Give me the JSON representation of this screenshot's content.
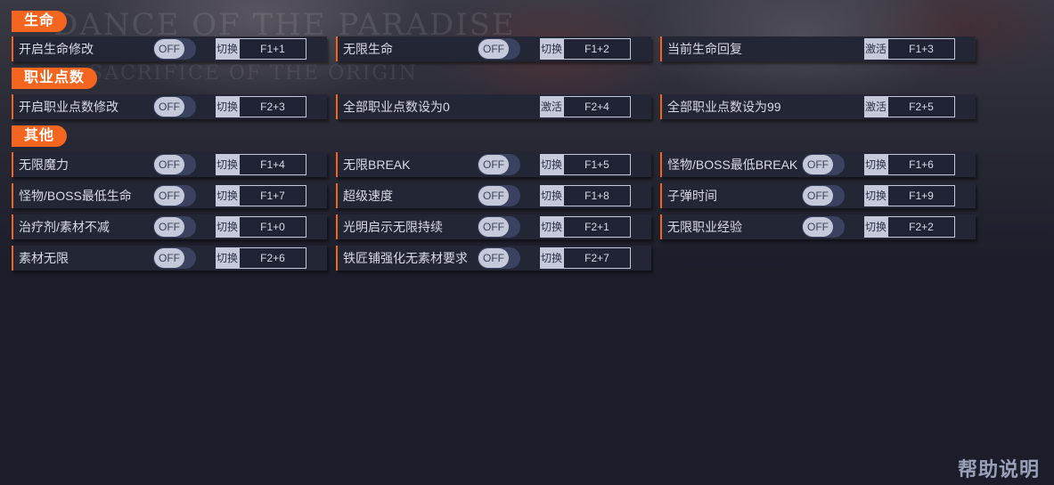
{
  "sections": [
    {
      "title": "生命",
      "options": [
        {
          "label": "开启生命修改",
          "toggle": "OFF",
          "action": "切换",
          "key": "F1+1"
        },
        {
          "label": "无限生命",
          "toggle": "OFF",
          "action": "切换",
          "key": "F1+2"
        },
        {
          "label": "当前生命回复",
          "toggle": null,
          "action": "激活",
          "key": "F1+3"
        }
      ]
    },
    {
      "title": "职业点数",
      "options": [
        {
          "label": "开启职业点数修改",
          "toggle": "OFF",
          "action": "切换",
          "key": "F2+3"
        },
        {
          "label": "全部职业点数设为0",
          "toggle": null,
          "action": "激活",
          "key": "F2+4"
        },
        {
          "label": "全部职业点数设为99",
          "toggle": null,
          "action": "激活",
          "key": "F2+5"
        }
      ]
    },
    {
      "title": "其他",
      "options": [
        {
          "label": "无限魔力",
          "toggle": "OFF",
          "action": "切换",
          "key": "F1+4"
        },
        {
          "label": "无限BREAK",
          "toggle": "OFF",
          "action": "切换",
          "key": "F1+5"
        },
        {
          "label": "怪物/BOSS最低BREAK",
          "toggle": "OFF",
          "action": "切换",
          "key": "F1+6"
        },
        {
          "label": "怪物/BOSS最低生命",
          "toggle": "OFF",
          "action": "切换",
          "key": "F1+7"
        },
        {
          "label": "超级速度",
          "toggle": "OFF",
          "action": "切换",
          "key": "F1+8"
        },
        {
          "label": "子弹时间",
          "toggle": "OFF",
          "action": "切换",
          "key": "F1+9"
        },
        {
          "label": "治疗剂/素材不减",
          "toggle": "OFF",
          "action": "切换",
          "key": "F1+0"
        },
        {
          "label": "光明启示无限持续",
          "toggle": "OFF",
          "action": "切换",
          "key": "F2+1"
        },
        {
          "label": "无限职业经验",
          "toggle": "OFF",
          "action": "切换",
          "key": "F2+2"
        },
        {
          "label": "素材无限",
          "toggle": "OFF",
          "action": "切换",
          "key": "F2+6"
        },
        {
          "label": "铁匠铺强化无素材要求",
          "toggle": "OFF",
          "action": "切换",
          "key": "F2+7"
        }
      ]
    }
  ],
  "help_label": "帮助说明",
  "background_text": "DANCE OF THE PARADISE",
  "background_subtext": "SACRIFICE OF THE ORIGIN",
  "colors": {
    "accent": "#f4661f",
    "background": "#1b1d2a",
    "row_background": "#232635",
    "toggle_track": "#3b4260",
    "toggle_knob": "#c5c9d9"
  }
}
